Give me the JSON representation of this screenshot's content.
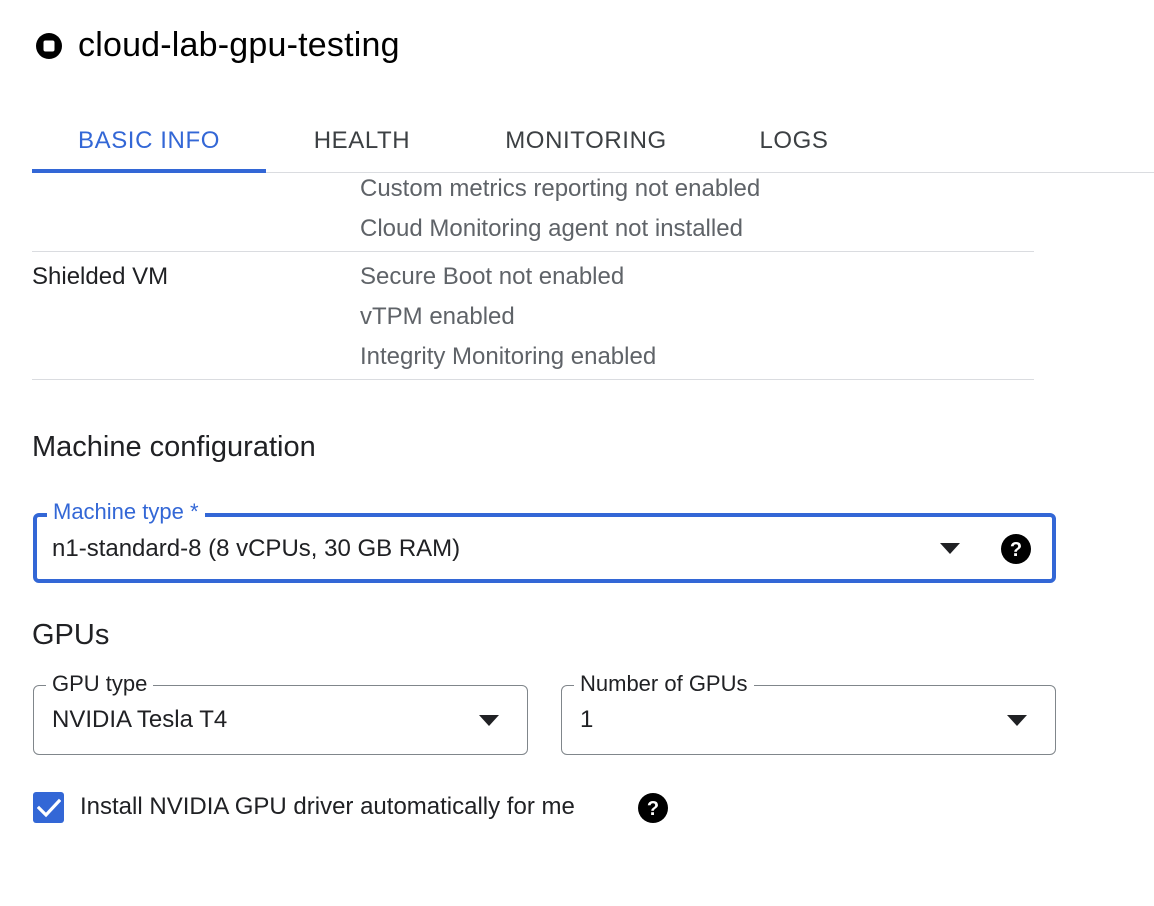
{
  "header": {
    "title": "cloud-lab-gpu-testing",
    "status_icon": "stopped-icon"
  },
  "tabs": [
    {
      "label": "BASIC INFO",
      "active": true
    },
    {
      "label": "HEALTH",
      "active": false
    },
    {
      "label": "MONITORING",
      "active": false
    },
    {
      "label": "LOGS",
      "active": false
    }
  ],
  "monitoring": {
    "lines": [
      "Custom metrics reporting not enabled",
      "Cloud Monitoring agent not installed"
    ]
  },
  "shielded_vm": {
    "label": "Shielded VM",
    "lines": [
      "Secure Boot not enabled",
      "vTPM enabled",
      "Integrity Monitoring enabled"
    ]
  },
  "machine_config": {
    "heading": "Machine configuration",
    "machine_type": {
      "label": "Machine type *",
      "value": "n1-standard-8 (8 vCPUs, 30 GB RAM)"
    }
  },
  "gpus": {
    "heading": "GPUs",
    "gpu_type": {
      "label": "GPU type",
      "value": "NVIDIA Tesla T4"
    },
    "gpu_count": {
      "label": "Number of GPUs",
      "value": "1"
    },
    "install_driver": {
      "label": "Install NVIDIA GPU driver automatically for me",
      "checked": true
    }
  },
  "colors": {
    "accent": "#3367d6",
    "text_primary": "#202124",
    "text_secondary": "#5f6368",
    "divider": "#dadce0"
  }
}
